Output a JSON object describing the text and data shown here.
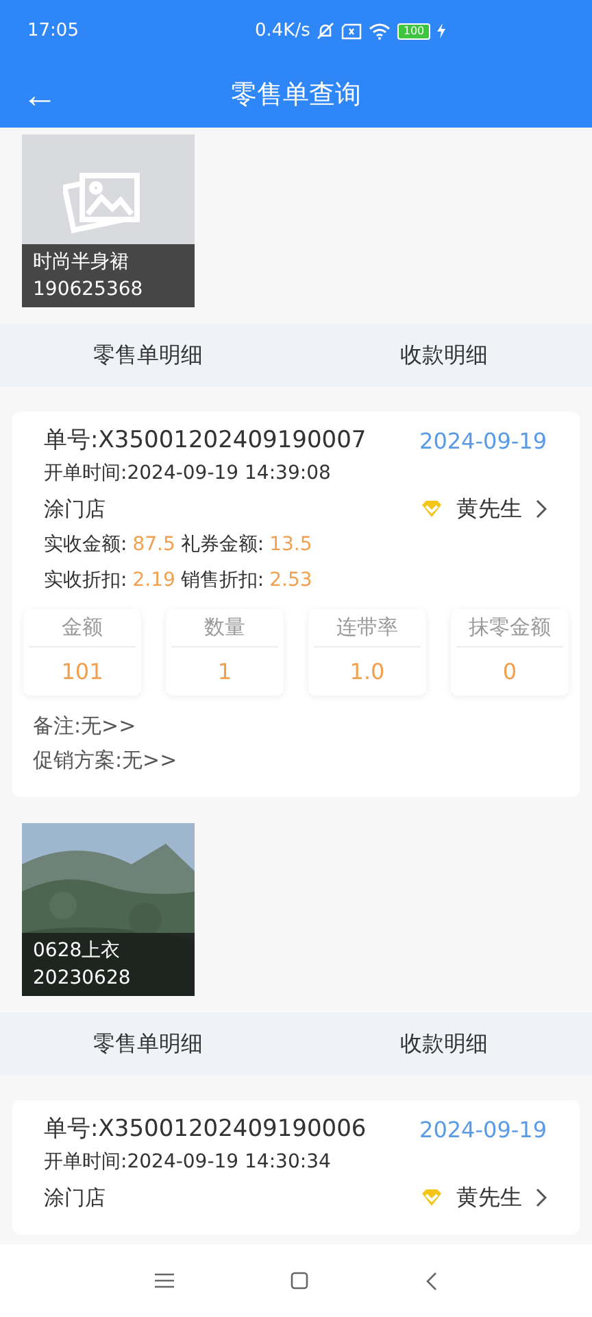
{
  "status_bar": {
    "time": "17:05",
    "speed": "0.4K/s",
    "battery": "100"
  },
  "header": {
    "back": "←",
    "title": "零售单查询"
  },
  "orders": [
    {
      "product": {
        "kind": "placeholder",
        "name": "时尚半身裙",
        "code": "190625368"
      },
      "tabs": [
        "零售单明细",
        "收款明细"
      ],
      "number": "单号:X35001202409190007",
      "date": "2024-09-19",
      "time": "开单时间:2024-09-19 14:39:08",
      "store": "涂门店",
      "customer": "黄先生",
      "amounts": [
        [
          {
            "label": "实收金额:",
            "value": "87.5"
          },
          {
            "label": "礼券金额:",
            "value": "13.5"
          }
        ],
        [
          {
            "label": "实收折扣:",
            "value": "2.19"
          },
          {
            "label": "销售折扣:",
            "value": "2.53"
          }
        ]
      ],
      "stats": [
        {
          "label": "金额",
          "value": "101"
        },
        {
          "label": "数量",
          "value": "1"
        },
        {
          "label": "连带率",
          "value": "1.0"
        },
        {
          "label": "抹零金额",
          "value": "0"
        }
      ],
      "notes": [
        "备注:无>>",
        "促销方案:无>>"
      ]
    },
    {
      "product": {
        "kind": "picture",
        "name": "0628上衣",
        "code": "20230628"
      },
      "tabs": [
        "零售单明细",
        "收款明细"
      ],
      "number": "单号:X35001202409190006",
      "date": "2024-09-19",
      "time": "开单时间:2024-09-19 14:30:34",
      "store": "涂门店",
      "customer": "黄先生"
    }
  ]
}
